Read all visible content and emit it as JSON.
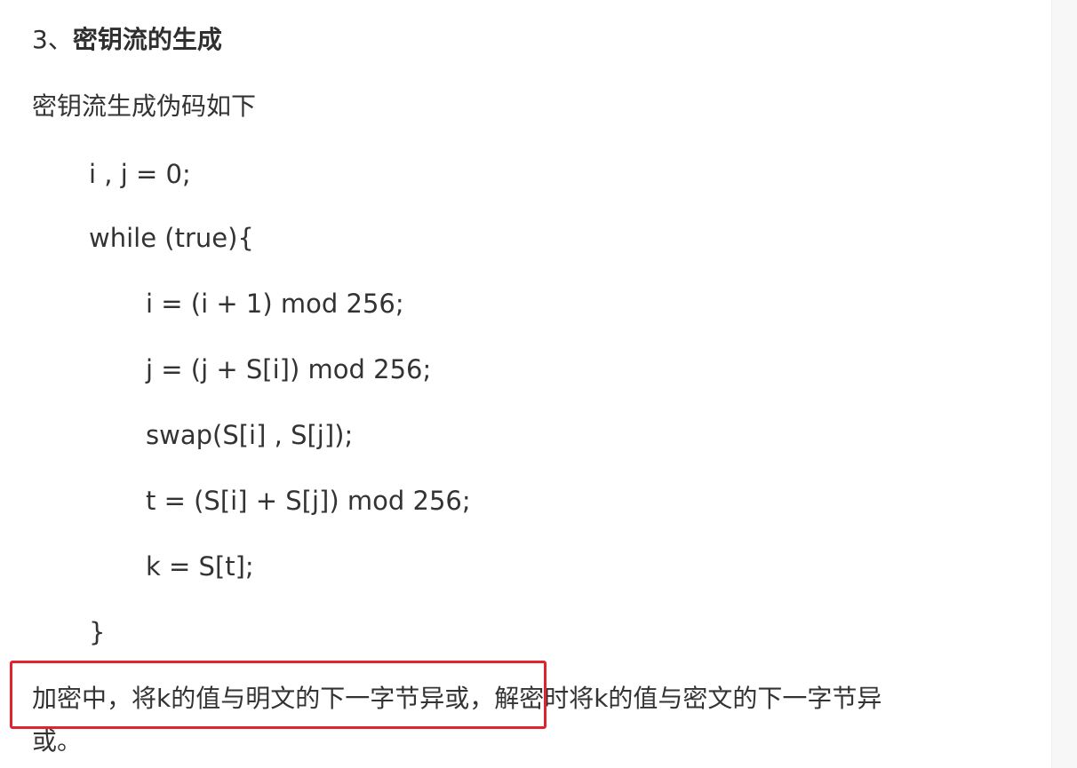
{
  "section": {
    "number": "3、",
    "title": "密钥流的生成"
  },
  "intro": "密钥流生成伪码如下",
  "code": {
    "line1": "i , j = 0;",
    "line2": "while (true){",
    "line3": "i = (i + 1) mod 256;",
    "line4": "j = (j + S[i]) mod 256;",
    "line5": "swap(S[i] , S[j]);",
    "line6": "t = (S[i] + S[j]) mod 256;",
    "line7": "k = S[t];",
    "line8": "}"
  },
  "closing": {
    "highlighted_part": "加密中，将k的值与明文的下一字节异或，",
    "rest_line1": "解密时将k的值与密文的下一字节异",
    "rest_line2": "或。"
  },
  "annotation": {
    "box_color": "#e0242b"
  }
}
